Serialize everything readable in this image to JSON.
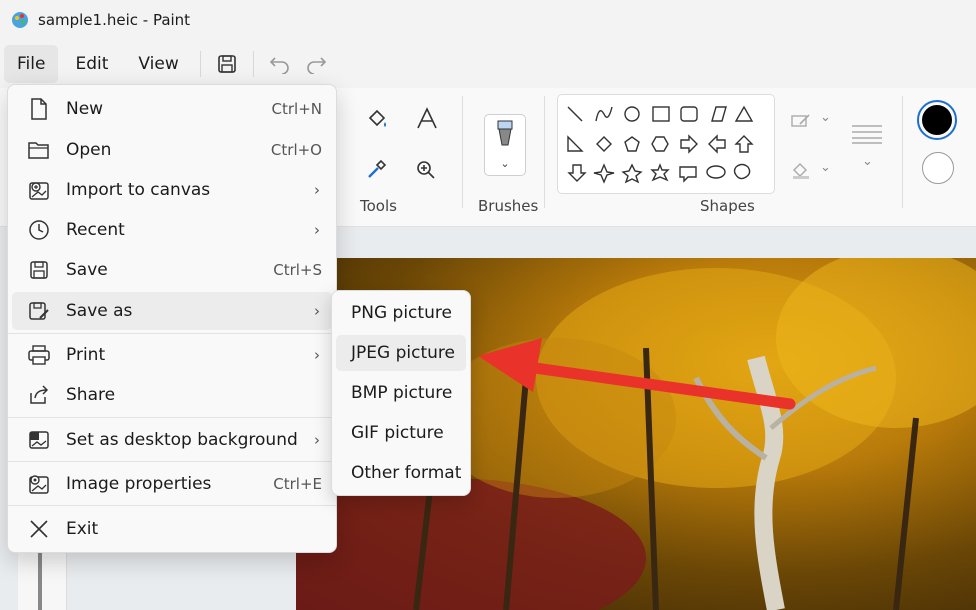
{
  "window": {
    "title": "sample1.heic - Paint"
  },
  "menubar": {
    "items": [
      {
        "label": "File",
        "active": true
      },
      {
        "label": "Edit"
      },
      {
        "label": "View"
      }
    ]
  },
  "ribbon": {
    "groups": {
      "tools": "Tools",
      "brushes": "Brushes",
      "shapes": "Shapes"
    },
    "colors": {
      "primary": "#000000",
      "secondary": "#ffffff"
    }
  },
  "file_menu": {
    "items": [
      {
        "label": "New",
        "shortcut": "Ctrl+N",
        "icon": "new-file-icon"
      },
      {
        "label": "Open",
        "shortcut": "Ctrl+O",
        "icon": "folder-icon"
      },
      {
        "label": "Import to canvas",
        "submenu": true,
        "icon": "import-icon"
      },
      {
        "label": "Recent",
        "submenu": true,
        "icon": "clock-icon"
      },
      {
        "label": "Save",
        "shortcut": "Ctrl+S",
        "icon": "save-icon"
      },
      {
        "label": "Save as",
        "submenu": true,
        "icon": "save-as-icon",
        "hover": true
      },
      {
        "label": "Print",
        "submenu": true,
        "icon": "printer-icon"
      },
      {
        "label": "Share",
        "icon": "share-icon"
      },
      {
        "label": "Set as desktop background",
        "submenu": true,
        "icon": "desktop-icon"
      },
      {
        "label": "Image properties",
        "shortcut": "Ctrl+E",
        "icon": "image-properties-icon"
      },
      {
        "label": "Exit",
        "icon": "close-icon"
      }
    ]
  },
  "save_as_menu": {
    "items": [
      {
        "label": "PNG picture"
      },
      {
        "label": "JPEG picture",
        "hover": true
      },
      {
        "label": "BMP picture"
      },
      {
        "label": "GIF picture"
      },
      {
        "label": "Other format"
      }
    ]
  },
  "annotation": {
    "color": "#e8322a"
  }
}
